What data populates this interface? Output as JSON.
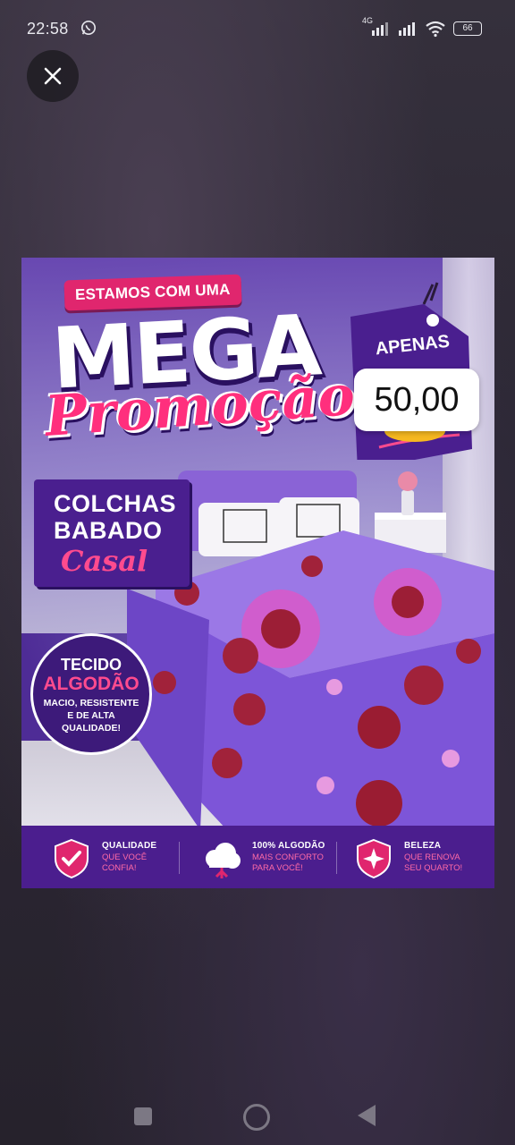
{
  "status": {
    "time": "22:58",
    "network": "4G",
    "battery": "66"
  },
  "viewer": {
    "close_icon": "close-icon"
  },
  "ad": {
    "pill_text": "ESTAMOS COM UMA",
    "headline": "MEGA",
    "headline_script": "Promoção!",
    "tag_label": "APENAS",
    "price": "50,00",
    "product": {
      "line1": "COLCHAS",
      "line2": "BABADO",
      "line3": "Casal"
    },
    "badge": {
      "line1": "TECIDO",
      "line2": "ALGODÃO",
      "line3": "MACIO, RESISTENTE",
      "line4": "E DE ALTA",
      "line5": "QUALIDADE!"
    },
    "features": [
      {
        "icon": "shield-check-icon",
        "title": "QUALIDADE",
        "line1": "QUE VOCÊ",
        "line2": "CONFIA!"
      },
      {
        "icon": "cotton-cloud-icon",
        "title": "100% ALGODÃO",
        "line1": "MAIS CONFORTO",
        "line2": "PARA VOCÊ!"
      },
      {
        "icon": "shield-sparkle-icon",
        "title": "BELEZA",
        "line1": "QUE RENOVA",
        "line2": "SEU QUARTO!"
      }
    ],
    "colors": {
      "purple": "#4b1e8e",
      "pink": "#e0266e"
    }
  },
  "navbar": {
    "recents_icon": "recents-icon",
    "home_icon": "home-icon",
    "back_icon": "back-icon"
  }
}
